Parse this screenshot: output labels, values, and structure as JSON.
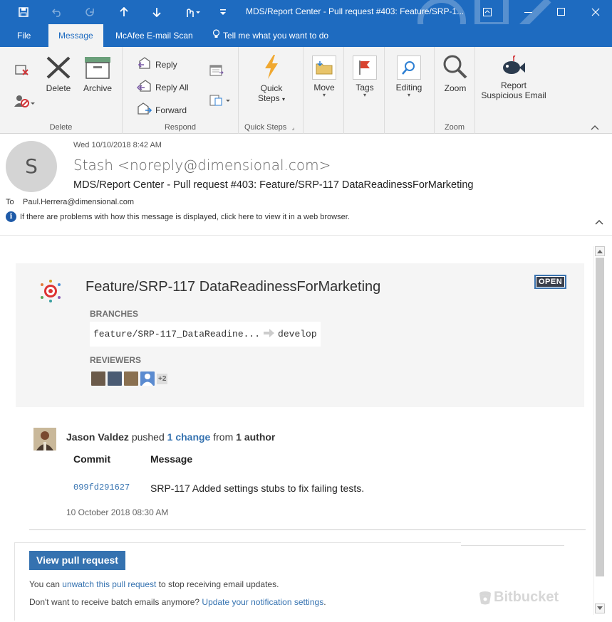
{
  "window": {
    "title": "MDS/Report Center - Pull request #403: Feature/SRP-1...",
    "minimize": "minimize-icon",
    "maximize": "maximize-icon",
    "close": "close-icon"
  },
  "quick_access": [
    "save-icon",
    "undo-icon",
    "redo-icon",
    "up-icon",
    "down-icon",
    "touch-icon",
    "customize-icon"
  ],
  "tabs": [
    {
      "label": "File"
    },
    {
      "label": "Message"
    },
    {
      "label": "McAfee E-mail Scan"
    },
    {
      "label": "Tell me what you want to do"
    }
  ],
  "ribbon": {
    "delete_group": {
      "label": "Delete",
      "delete": "Delete",
      "archive": "Archive"
    },
    "respond_group": {
      "label": "Respond",
      "reply": "Reply",
      "reply_all": "Reply All",
      "forward": "Forward"
    },
    "quicksteps_group": {
      "label": "Quick Steps",
      "quick_steps_line1": "Quick",
      "quick_steps_line2": "Steps"
    },
    "move": "Move",
    "tags": "Tags",
    "editing": "Editing",
    "zoom_group": {
      "label": "Zoom",
      "zoom": "Zoom"
    },
    "report": {
      "line1": "Report",
      "line2": "Suspicious Email"
    }
  },
  "header": {
    "avatar_initial": "S",
    "date": "Wed 10/10/2018 8:42 AM",
    "sender": "Stash <noreply@dimensional.com>",
    "subject": "MDS/Report Center - Pull request #403: Feature/SRP-117 DataReadinessForMarketing",
    "to_label": "To",
    "to_value": "Paul.Herrera@dimensional.com",
    "info": "If there are problems with how this message is displayed, click here to view it in a web browser."
  },
  "pr": {
    "title": "Feature/SRP-117 DataReadinessForMarketing",
    "status": "OPEN",
    "branches_label": "BRANCHES",
    "source_branch": "feature/SRP-117_DataReadine...",
    "target_branch": "develop",
    "reviewers_label": "REVIEWERS",
    "reviewers_more": "+2"
  },
  "activity": {
    "author": "Jason Valdez",
    "verb": " pushed ",
    "changes": "1 change",
    "from": " from ",
    "authors": "1 author",
    "col_commit": "Commit",
    "col_message": "Message",
    "commit_hash": "099fd291627",
    "commit_message": "SRP-117 Added settings stubs to fix failing tests.",
    "date": "10 October 2018 08:30 AM"
  },
  "footer": {
    "view_button": "View pull request",
    "unwatch_pre": "You can ",
    "unwatch_link": "unwatch this pull request",
    "unwatch_post": " to stop receiving email updates.",
    "batch_pre": "Don't want to receive batch emails anymore? ",
    "batch_link": "Update your notification settings",
    "batch_post": ".",
    "brand": "Bitbucket"
  }
}
